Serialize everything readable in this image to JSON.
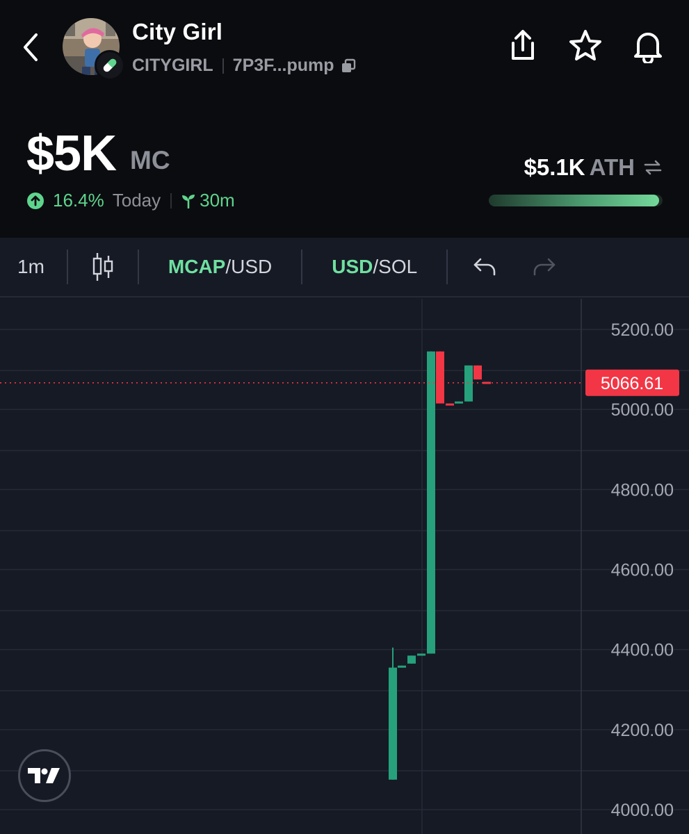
{
  "token": {
    "name": "City Girl",
    "ticker": "CITYGIRL",
    "address": "7P3F...pump"
  },
  "icons": {
    "back": "chevron-left-icon",
    "share": "share-icon",
    "favorite": "star-icon",
    "alerts": "bell-icon",
    "copy": "copy-icon",
    "badge": "pill-icon",
    "swap": "swap-icon",
    "age": "sprout-icon",
    "undo": "undo-icon",
    "redo": "redo-icon",
    "candles": "candlestick-icon",
    "logo": "tradingview-logo"
  },
  "market": {
    "value": "$5K",
    "unit": "MC",
    "change_pct": "16.4%",
    "change_period": "Today",
    "age": "30m",
    "ath_value": "$5.1K",
    "ath_label": "ATH",
    "ath_progress": 0.98
  },
  "toolbar": {
    "interval": "1m",
    "mcap_accent": "MCAP",
    "mcap_rest": "/USD",
    "quote_accent": "USD",
    "quote_rest": "/SOL"
  },
  "colors": {
    "up": "#26a17b",
    "down": "#f23645",
    "accent_green": "#5fd48d",
    "background": "#0b0c10",
    "chart_background": "#161a25"
  },
  "chart_data": {
    "type": "candlestick",
    "y_axis_ticks": [
      "5200.00",
      "5000.00",
      "4800.00",
      "4600.00",
      "4400.00",
      "4200.00",
      "4000.00"
    ],
    "ylim": [
      4000,
      5200
    ],
    "current_price": 5066.61,
    "current_price_label": "5066.61",
    "grid": true,
    "candles": [
      {
        "open": 4075,
        "close": 4355,
        "high": 4405,
        "low": 4075
      },
      {
        "open": 4355,
        "close": 4360,
        "high": 4360,
        "low": 4355
      },
      {
        "open": 4365,
        "close": 4385,
        "high": 4385,
        "low": 4365
      },
      {
        "open": 4385,
        "close": 4390,
        "high": 4390,
        "low": 4385
      },
      {
        "open": 4390,
        "close": 5145,
        "high": 5145,
        "low": 4390
      },
      {
        "open": 5145,
        "close": 5015,
        "high": 5145,
        "low": 5015
      },
      {
        "open": 5015,
        "close": 5013,
        "high": 5015,
        "low": 5013
      },
      {
        "open": 5015,
        "close": 5020,
        "high": 5020,
        "low": 5015
      },
      {
        "open": 5020,
        "close": 5110,
        "high": 5110,
        "low": 5020
      },
      {
        "open": 5110,
        "close": 5075,
        "high": 5110,
        "low": 5075
      },
      {
        "open": 5069,
        "close": 5067,
        "high": 5069,
        "low": 5067
      }
    ]
  }
}
